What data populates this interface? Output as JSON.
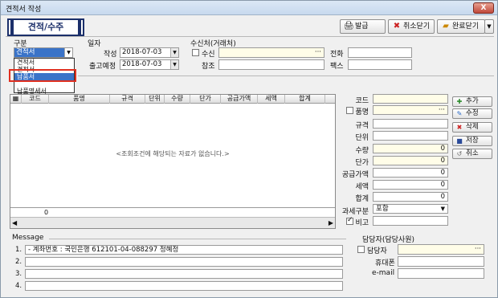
{
  "window": {
    "title": "견적서 작성",
    "close": "X"
  },
  "header": {
    "title": "견적/수주"
  },
  "toolbar": {
    "print": "발급",
    "cancel_close": "취소닫기",
    "done_close": "완료닫기"
  },
  "form": {
    "type_label": "구분",
    "type_value": "견적서",
    "type_options": [
      "견적서",
      "견적서",
      "납품서",
      "",
      "납품명세서"
    ],
    "date_label": "일자",
    "write_label": "작성",
    "write_date": "2018-07-03",
    "ship_label": "출고예정",
    "ship_date": "2018-07-03",
    "recipient_label": "수신처(거래처)",
    "recv_label": "수신",
    "recv_value": "",
    "ref_label": "참조",
    "ref_value": "",
    "phone_label": "전화",
    "phone_value": "",
    "fax_label": "팩스",
    "fax_value": ""
  },
  "grid": {
    "columns": [
      "코드",
      "품명",
      "규격",
      "단위",
      "수량",
      "단가",
      "공급가액",
      "세액",
      "합계"
    ],
    "empty_msg": "<조회조건에 해당되는 자료가 없습니다.>",
    "footer_value": "0"
  },
  "detail": {
    "code_label": "코드",
    "name_label": "품명",
    "spec_label": "규격",
    "unit_label": "단위",
    "qty_label": "수량",
    "qty": "0",
    "price_label": "단가",
    "price": "0",
    "supply_label": "공급가액",
    "supply": "0",
    "tax_label": "세액",
    "tax": "0",
    "total_label": "합계",
    "total": "0",
    "taxtype_label": "과세구분",
    "taxtype": "포함",
    "note_label": "비고"
  },
  "side_buttons": {
    "add": "추가",
    "edit": "수정",
    "delete": "삭제",
    "save": "저장",
    "cancel": "취소"
  },
  "message": {
    "title": "Message",
    "lines": [
      "- 계좌번호 : 국민은행 612101-04-088297 정혜정",
      "",
      "",
      ""
    ],
    "nums": [
      "1.",
      "2.",
      "3.",
      "4."
    ]
  },
  "manager": {
    "title": "담당자(담당사원)",
    "name_label": "담당자",
    "mobile_label": "휴대폰",
    "email_label": "e-mail"
  }
}
